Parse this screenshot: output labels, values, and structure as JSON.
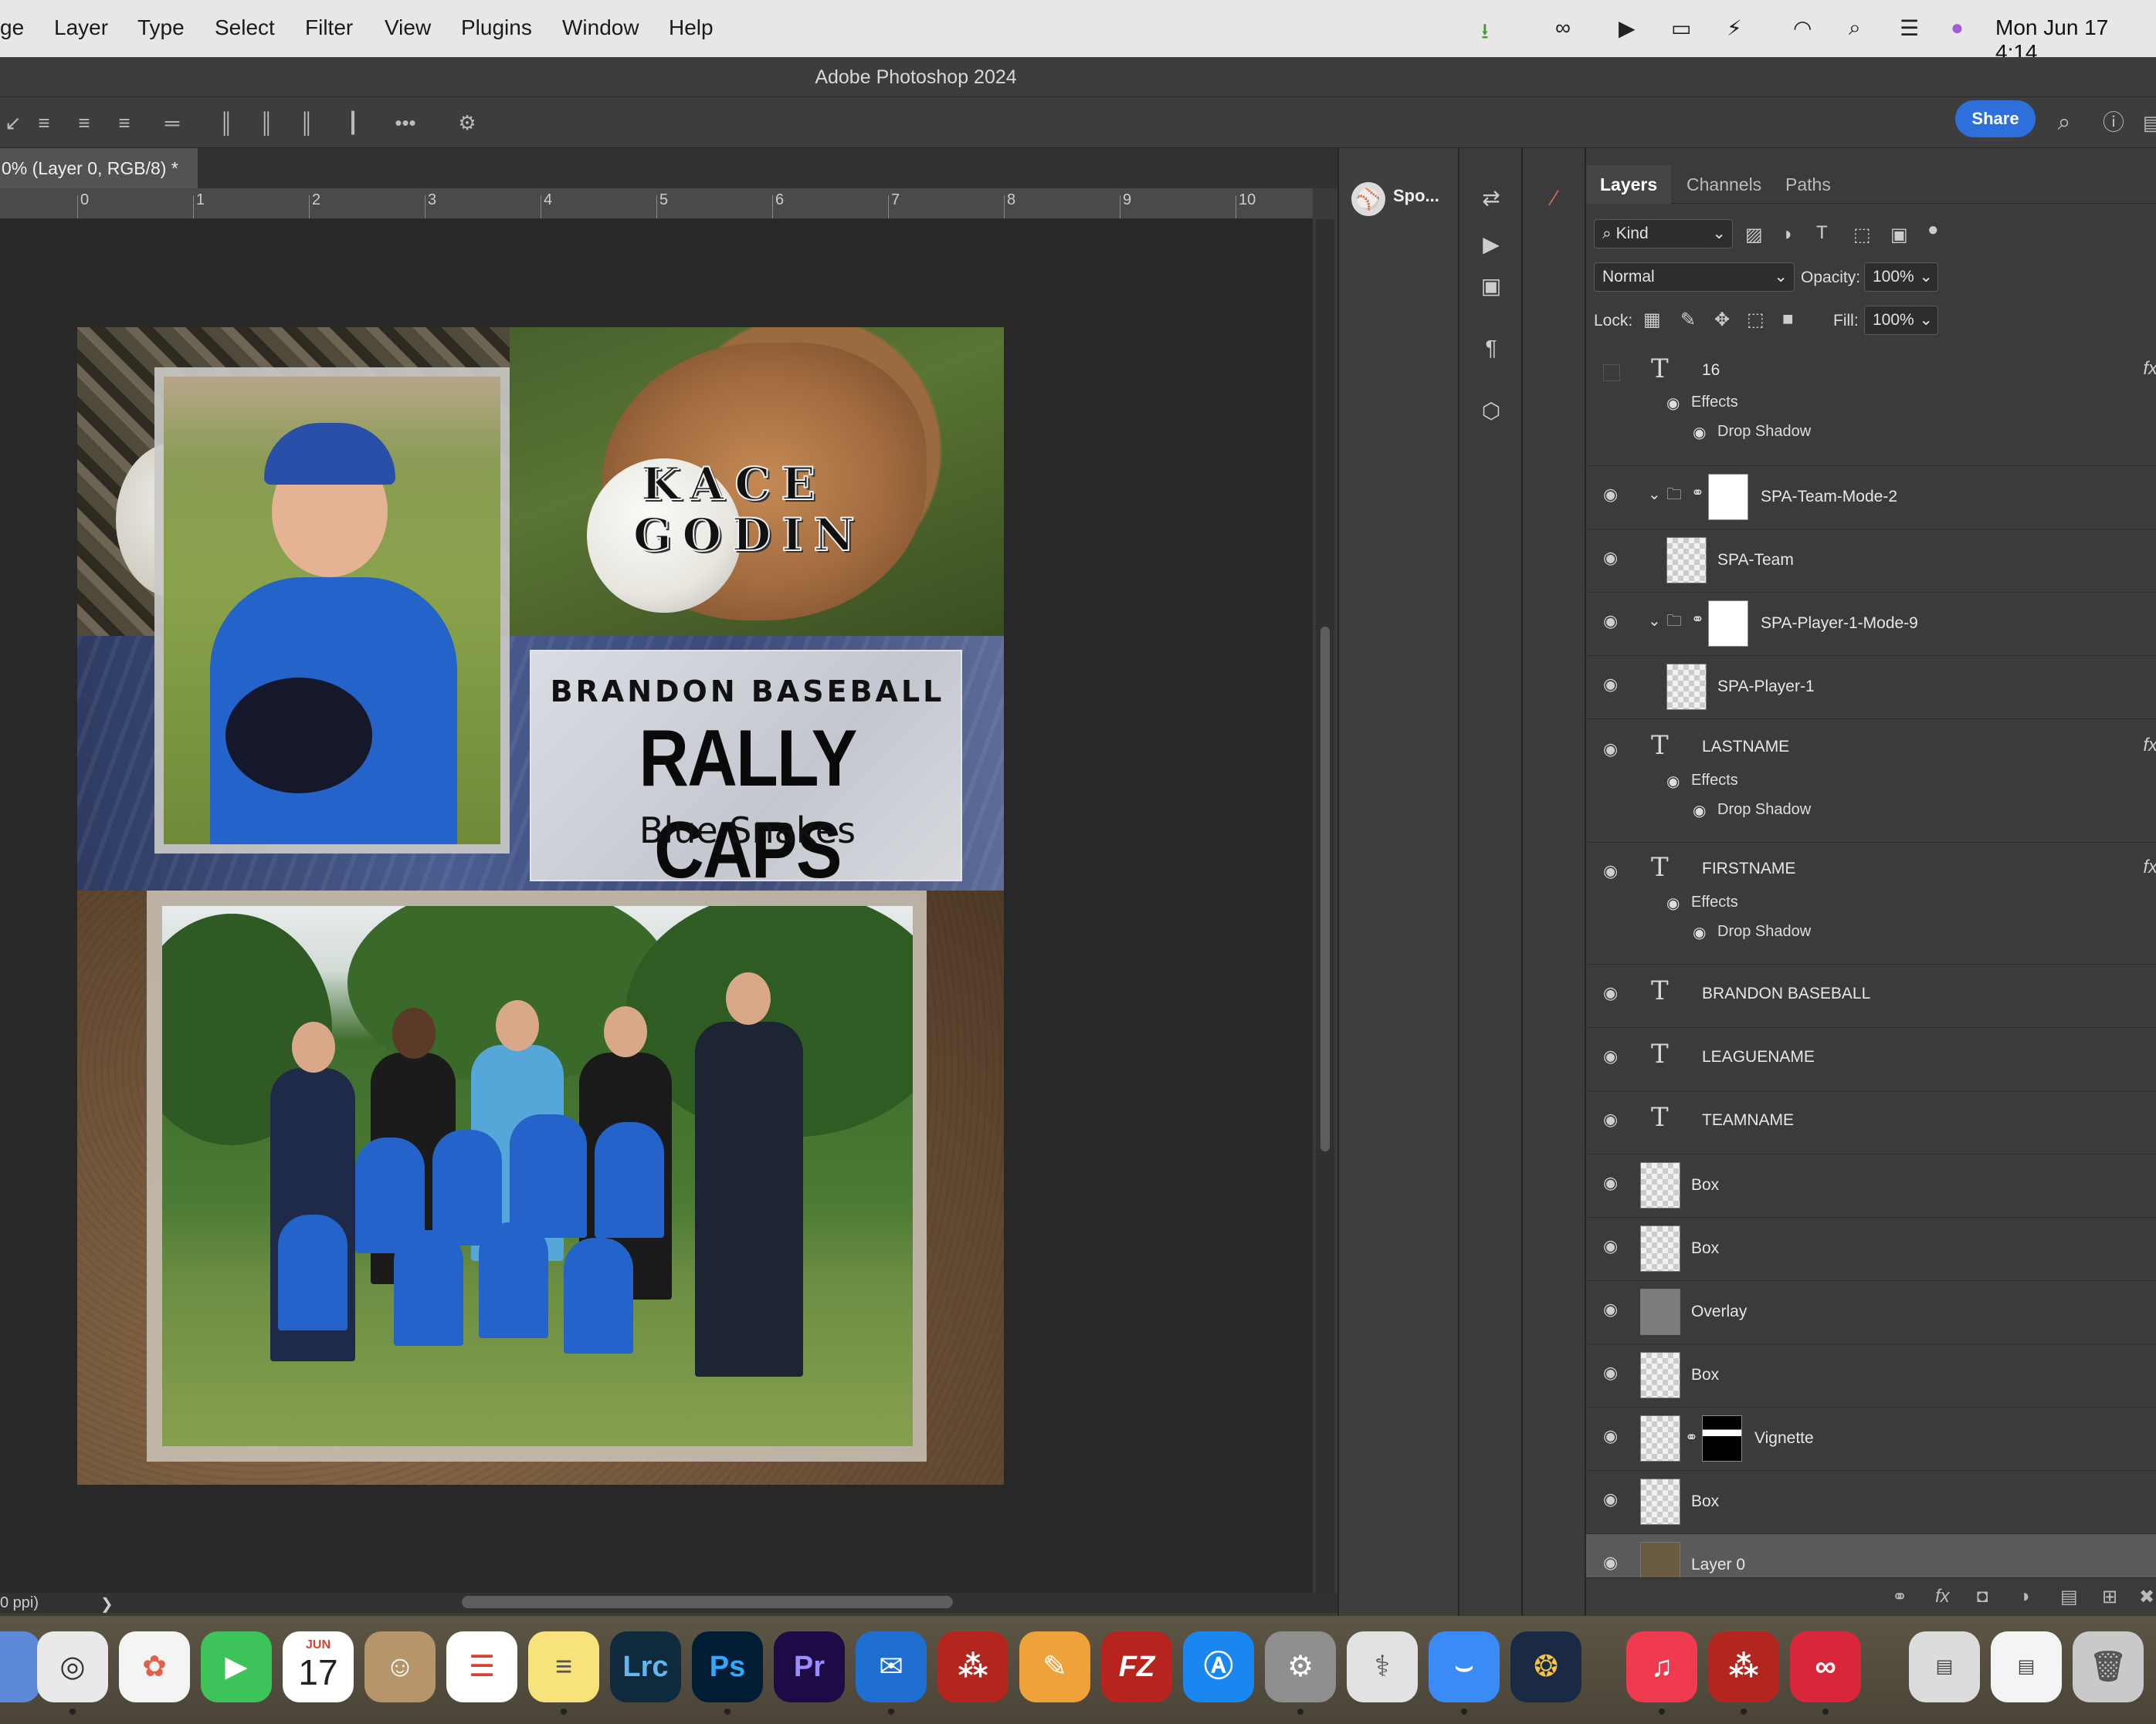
{
  "menubar": {
    "items": [
      "ge",
      "Layer",
      "Type",
      "Select",
      "Filter",
      "View",
      "Plugins",
      "Window",
      "Help"
    ],
    "clock": "Mon Jun 17  4:14"
  },
  "window": {
    "title": "Adobe Photoshop 2024",
    "share_label": "Share"
  },
  "doc_tab": {
    "label": "0% (Layer 0, RGB/8) *"
  },
  "ruler": {
    "ticks": [
      "0",
      "1",
      "2",
      "3",
      "4",
      "5",
      "6",
      "7",
      "8",
      "9",
      "10"
    ]
  },
  "artwork": {
    "firstname": "KACE",
    "lastname": "GODIN",
    "league": "BRANDON BASEBALL",
    "leaguename": "RALLY CAPS",
    "teamname": "Blue Snakes"
  },
  "status": {
    "left": "0 ppi)",
    "arrow": "❯"
  },
  "side_panel": {
    "spo_label": "Spo..."
  },
  "layers_panel": {
    "tabs": [
      "Layers",
      "Channels",
      "Paths"
    ],
    "filter_label": "Kind",
    "blend_mode": "Normal",
    "opacity_label": "Opacity:",
    "opacity_value": "100%",
    "lock_label": "Lock:",
    "fill_label": "Fill:",
    "fill_value": "100%",
    "effects_label": "Effects",
    "drop_shadow_label": "Drop Shadow",
    "layers": [
      {
        "name": "16",
        "kind": "text",
        "visible": false,
        "fx": true
      },
      {
        "name": "SPA-Team-Mode-2",
        "kind": "group",
        "visible": true
      },
      {
        "name": "SPA-Team",
        "kind": "smart",
        "visible": true
      },
      {
        "name": "SPA-Player-1-Mode-9",
        "kind": "group",
        "visible": true
      },
      {
        "name": "SPA-Player-1",
        "kind": "smart",
        "visible": true
      },
      {
        "name": "LASTNAME",
        "kind": "text",
        "visible": true,
        "fx": true
      },
      {
        "name": "FIRSTNAME",
        "kind": "text",
        "visible": true,
        "fx": true
      },
      {
        "name": "BRANDON BASEBALL",
        "kind": "text",
        "visible": true
      },
      {
        "name": "LEAGUENAME",
        "kind": "text",
        "visible": true
      },
      {
        "name": "TEAMNAME",
        "kind": "text",
        "visible": true
      },
      {
        "name": "Box",
        "kind": "smart",
        "visible": true
      },
      {
        "name": "Box",
        "kind": "smart",
        "visible": true
      },
      {
        "name": "Overlay",
        "kind": "image",
        "visible": true
      },
      {
        "name": "Box",
        "kind": "smart",
        "visible": true
      },
      {
        "name": "Vignette",
        "kind": "masked",
        "visible": true
      },
      {
        "name": "Box",
        "kind": "smart",
        "visible": true
      },
      {
        "name": "Layer 0",
        "kind": "image",
        "visible": true
      }
    ]
  },
  "dock": {
    "apps": [
      {
        "name": "Chrome",
        "label": "",
        "color": "#e9e9e9"
      },
      {
        "name": "Photos",
        "label": "",
        "color": "#f4f4f4"
      },
      {
        "name": "FaceTime",
        "label": "",
        "color": "#3cc35a"
      },
      {
        "name": "Calendar",
        "label": "17",
        "color": "#ffffff"
      },
      {
        "name": "Contacts",
        "label": "",
        "color": "#b7956a"
      },
      {
        "name": "Reminders",
        "label": "",
        "color": "#ffffff"
      },
      {
        "name": "Notes",
        "label": "",
        "color": "#f8e37a"
      },
      {
        "name": "Lightroom Classic",
        "label": "Lrc",
        "color": "#0f2a3d"
      },
      {
        "name": "Photoshop",
        "label": "Ps",
        "color": "#001d34"
      },
      {
        "name": "Premiere Pro",
        "label": "Pr",
        "color": "#1e0a45"
      },
      {
        "name": "Mail",
        "label": "",
        "color": "#1f6fd0"
      },
      {
        "name": "Acrobat",
        "label": "",
        "color": "#b3261e"
      },
      {
        "name": "Pages",
        "label": "",
        "color": "#f0a23a"
      },
      {
        "name": "FileZilla Pro",
        "label": "FZ",
        "color": "#b7241e"
      },
      {
        "name": "App Store",
        "label": "",
        "color": "#1a86f0"
      },
      {
        "name": "System Settings",
        "label": "",
        "color": "#8f8f8f"
      },
      {
        "name": "Stethoscope",
        "label": "",
        "color": "#e2e2e2"
      },
      {
        "name": "Freeform",
        "label": "",
        "color": "#3a8bf5"
      },
      {
        "name": "Aperture",
        "label": "",
        "color": "#1a2a45"
      },
      {
        "name": "Music",
        "label": "",
        "color": "#f03a4f"
      },
      {
        "name": "Acrobat Reader",
        "label": "",
        "color": "#b3261e"
      },
      {
        "name": "Creative Cloud",
        "label": "",
        "color": "#d9263b"
      }
    ],
    "calendar_month": "JUN"
  },
  "colors": {
    "accent": "#2d6fdb",
    "panel": "#3b3b3b",
    "canvas": "#282828"
  }
}
